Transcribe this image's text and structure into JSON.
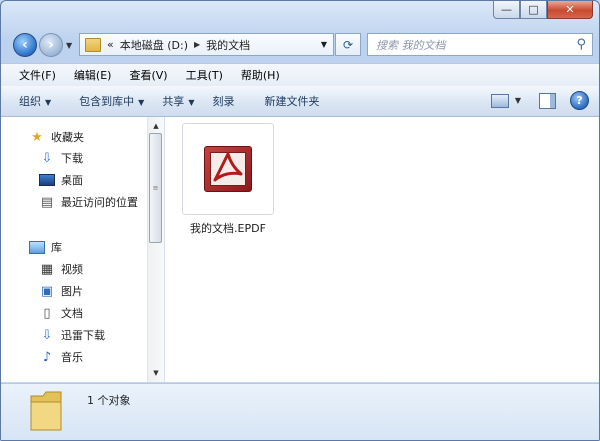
{
  "window": {
    "controls": {
      "minimize": "—",
      "maximize": "□",
      "close": "✕"
    }
  },
  "navigation": {
    "address": {
      "overflow": "«",
      "segments": [
        "本地磁盘 (D:)",
        "我的文档"
      ]
    },
    "search": {
      "placeholder": "搜索 我的文档"
    }
  },
  "menubar": {
    "items": [
      "文件(F)",
      "编辑(E)",
      "查看(V)",
      "工具(T)",
      "帮助(H)"
    ]
  },
  "commandbar": {
    "organize": "组织",
    "include_in_library": "包含到库中",
    "share": "共享",
    "burn": "刻录",
    "new_folder": "新建文件夹"
  },
  "navpane": {
    "favorites": {
      "label": "收藏夹",
      "items": [
        {
          "label": "下载",
          "icon": "download-folder-icon"
        },
        {
          "label": "桌面",
          "icon": "desktop-icon"
        },
        {
          "label": "最近访问的位置",
          "icon": "recent-places-icon"
        }
      ]
    },
    "libraries": {
      "label": "库",
      "items": [
        {
          "label": "视频",
          "icon": "videos-icon"
        },
        {
          "label": "图片",
          "icon": "pictures-icon"
        },
        {
          "label": "文档",
          "icon": "documents-icon"
        },
        {
          "label": "迅雷下载",
          "icon": "thunder-download-icon"
        },
        {
          "label": "音乐",
          "icon": "music-icon"
        }
      ]
    }
  },
  "content": {
    "files": [
      {
        "name": "我的文档.EPDF",
        "icon": "pdf-file-icon"
      }
    ]
  },
  "details": {
    "count_text": "1 个对象"
  }
}
